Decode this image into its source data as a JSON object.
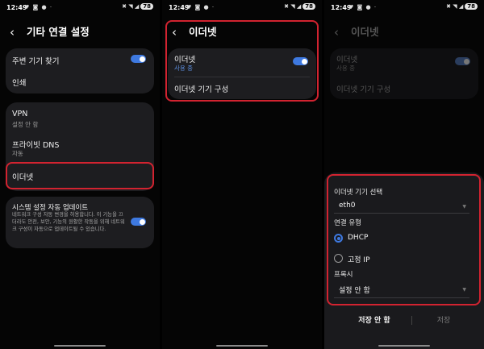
{
  "status": {
    "time": "12:49",
    "notif_icons": "♥ ◙ ● ·",
    "sys_icons": "✖ ◥ ◢",
    "battery": "78"
  },
  "colors": {
    "accent": "#3e79e0",
    "highlight": "#d22330",
    "card": "#1d1d20",
    "background": "#050505"
  },
  "screen1": {
    "title": "기타 연결 설정",
    "nearby_label": "주변 기기 찾기",
    "nearby_on": true,
    "print_label": "인쇄",
    "vpn_label": "VPN",
    "vpn_sub": "설정 안 함",
    "dns_label": "프라이빗 DNS",
    "dns_sub": "자동",
    "ethernet_label": "이더넷",
    "auto_update_title": "시스템 설정 자동 업데이트",
    "auto_update_desc": "네트워크 구성 자동 변경을 허용합니다. 이 기능을 끄더라도 안전, 보안, 기능의 원활한 작동을 위해 네트워크 구성이 자동으로 업데이트될 수 있습니다.",
    "auto_update_on": true
  },
  "screen2": {
    "title": "이더넷",
    "ethernet_label": "이더넷",
    "ethernet_sub": "사용 중",
    "ethernet_on": true,
    "configure_label": "이더넷 기기 구성"
  },
  "screen3": {
    "title": "이더넷",
    "ethernet_label": "이더넷",
    "ethernet_sub": "사용 중",
    "configure_label": "이더넷 기기 구성",
    "dialog": {
      "device_label": "이더넷 기기 선택",
      "device_value": "eth0",
      "conn_type_label": "연결 유형",
      "dhcp_label": "DHCP",
      "static_label": "고정 IP",
      "selected": "DHCP",
      "proxy_label": "프록시",
      "proxy_value": "설정 안 함",
      "cancel_label": "저장 안 함",
      "save_label": "저장"
    }
  }
}
